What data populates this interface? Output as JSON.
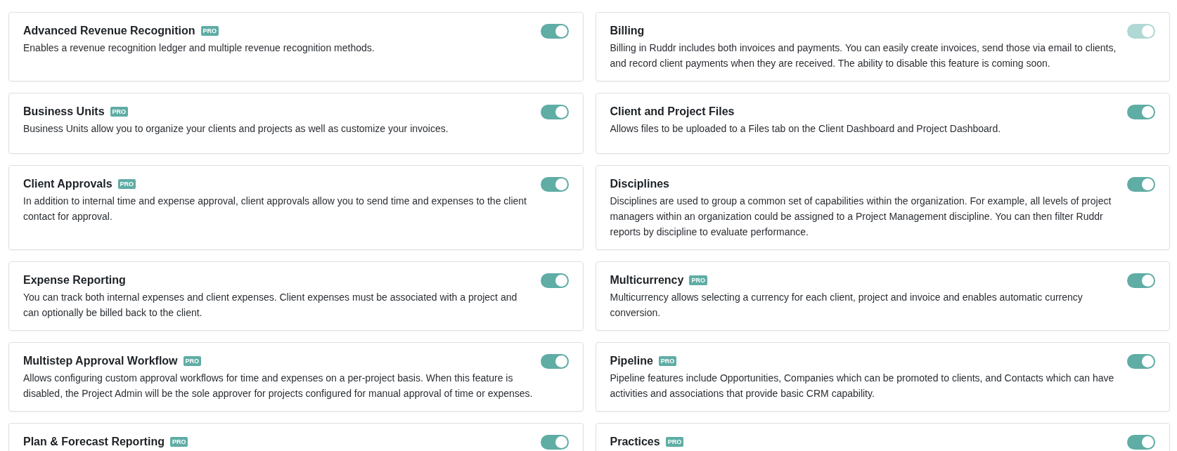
{
  "features": [
    {
      "title": "Advanced Revenue Recognition",
      "badge": "PRO",
      "on": true,
      "disabled": false,
      "description": "Enables a revenue recognition ledger and multiple revenue recognition methods."
    },
    {
      "title": "Billing",
      "on": true,
      "disabled": true,
      "description": "Billing in Ruddr includes both invoices and payments. You can easily create invoices, send those via email to clients, and record client payments when they are received. The ability to disable this feature is coming soon."
    },
    {
      "title": "Business Units",
      "badge": "PRO",
      "on": true,
      "disabled": false,
      "description": "Business Units allow you to organize your clients and projects as well as customize your invoices."
    },
    {
      "title": "Client and Project Files",
      "on": true,
      "disabled": false,
      "description": "Allows files to be uploaded to a Files tab on the Client Dashboard and Project Dashboard."
    },
    {
      "title": "Client Approvals",
      "badge": "PRO",
      "on": true,
      "disabled": false,
      "description": "In addition to internal time and expense approval, client approvals allow you to send time and expenses to the client contact for approval."
    },
    {
      "title": "Disciplines",
      "on": true,
      "disabled": false,
      "description": "Disciplines are used to group a common set of capabilities within the organization. For example, all levels of project managers within an organization could be assigned to a Project Management discipline. You can then filter Ruddr reports by discipline to evaluate performance."
    },
    {
      "title": "Expense Reporting",
      "on": true,
      "disabled": false,
      "description": "You can track both internal expenses and client expenses. Client expenses must be associated with a project and can optionally be billed back to the client."
    },
    {
      "title": "Multicurrency",
      "badge": "PRO",
      "on": true,
      "disabled": false,
      "description": "Multicurrency allows selecting a currency for each client, project and invoice and enables automatic currency conversion."
    },
    {
      "title": "Multistep Approval Workflow",
      "badge": "PRO",
      "on": true,
      "disabled": false,
      "description": "Allows configuring custom approval workflows for time and expenses on a per-project basis. When this feature is disabled, the Project Admin will be the sole approver for projects configured for manual approval of time or expenses."
    },
    {
      "title": "Pipeline",
      "badge": "PRO",
      "on": true,
      "disabled": false,
      "description": "Pipeline features include Opportunities, Companies which can be promoted to clients, and Contacts which can have activities and associations that provide basic CRM capability."
    },
    {
      "title": "Plan & Forecast Reporting",
      "badge": "PRO",
      "on": true,
      "disabled": false
    },
    {
      "title": "Practices",
      "badge": "PRO",
      "on": true,
      "disabled": false
    }
  ]
}
